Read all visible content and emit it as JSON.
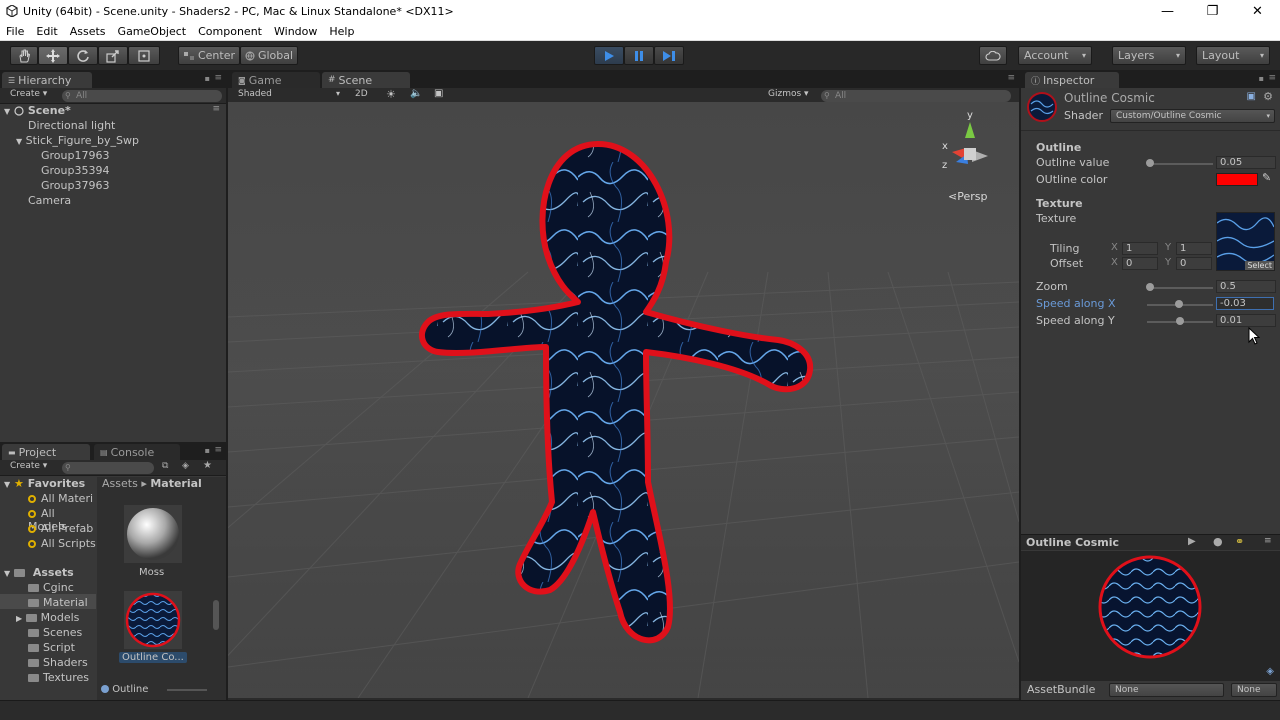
{
  "window": {
    "title": "Unity (64bit) - Scene.unity - Shaders2 - PC, Mac & Linux Standalone* <DX11>",
    "controls": [
      "—",
      "❐",
      "✕"
    ]
  },
  "menu": [
    "File",
    "Edit",
    "Assets",
    "GameObject",
    "Component",
    "Window",
    "Help"
  ],
  "toolbar": {
    "pivot": "Center",
    "space": "Global",
    "account": "Account",
    "layers": "Layers",
    "layout": "Layout"
  },
  "hierarchy": {
    "tab": "Hierarchy",
    "create": "Create",
    "search_placeholder": "All",
    "scene": "Scene*",
    "items": [
      {
        "label": "Directional light"
      },
      {
        "label": "Stick_Figure_by_Swp"
      },
      {
        "label": "Group17963"
      },
      {
        "label": "Group35394"
      },
      {
        "label": "Group37963"
      },
      {
        "label": "Camera"
      }
    ]
  },
  "views": {
    "game_tab": "Game",
    "scene_tab": "Scene",
    "shading_mode": "Shaded",
    "mode_2d": "2D",
    "gizmos": "Gizmos",
    "search_placeholder": "All",
    "persp": "Persp",
    "axis_x": "x",
    "axis_y": "y",
    "axis_z": "z"
  },
  "project": {
    "tab": "Project",
    "console_tab": "Console",
    "create": "Create",
    "favorites_label": "Favorites",
    "favorites": [
      "All Materi",
      "All Models",
      "All Prefab",
      "All Scripts"
    ],
    "assets_label": "Assets",
    "folders": [
      "Cginc",
      "Material",
      "Models",
      "Scenes",
      "Script",
      "Shaders",
      "Textures"
    ],
    "breadcrumb_root": "Assets",
    "breadcrumb_sep": "▸",
    "breadcrumb_leaf": "Material",
    "asset_items": [
      {
        "label": "Moss"
      },
      {
        "label": "Outline Co..."
      }
    ],
    "footer_item": "Outline"
  },
  "inspector": {
    "tab": "Inspector",
    "material_name": "Outline Cosmic",
    "shader_label": "Shader",
    "shader_value": "Custom/Outline Cosmic",
    "sections": {
      "outline": "Outline",
      "texture": "Texture"
    },
    "outline_value_label": "Outline value",
    "outline_value": "0.05",
    "outline_color_label": "OUtline color",
    "outline_color": "#ff0000",
    "texture_label": "Texture",
    "tiling_label": "Tiling",
    "offset_label": "Offset",
    "tiling_x": "1",
    "tiling_y": "1",
    "offset_x": "0",
    "offset_y": "0",
    "x_label": "X",
    "y_label": "Y",
    "select": "Select",
    "zoom_label": "Zoom",
    "zoom_value": "0.5",
    "speed_x_label": "Speed along X",
    "speed_x_value": "-0.03",
    "speed_y_label": "Speed along Y",
    "speed_y_value": "0.01",
    "preview_title": "Outline Cosmic",
    "assetbundle_label": "AssetBundle",
    "assetbundle_value": "None",
    "assetbundle_variant": "None"
  },
  "colors": {
    "accent": "#3e8ee8",
    "outline_red": "#e0101a",
    "selection": "#2c4b6b"
  }
}
